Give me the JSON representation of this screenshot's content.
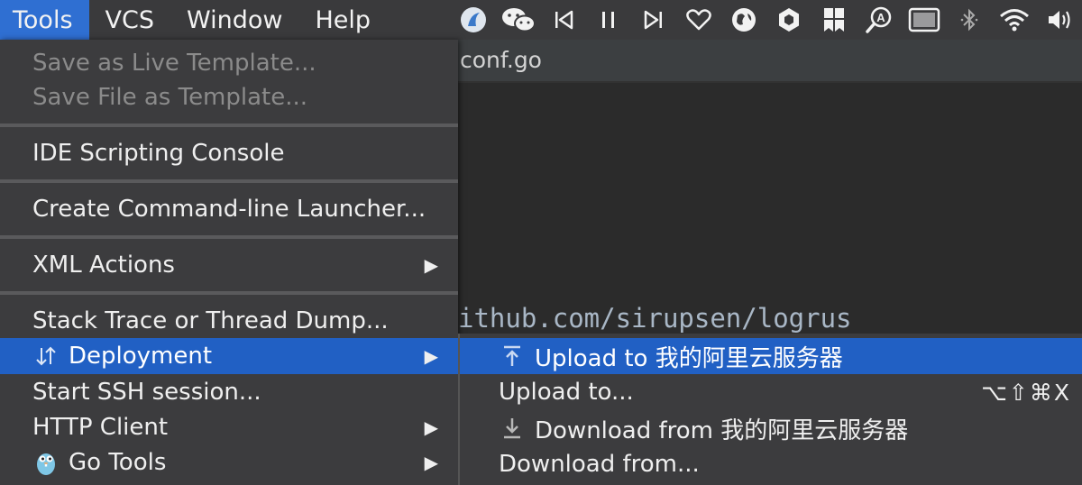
{
  "menubar": {
    "menus": [
      "Tools",
      "VCS",
      "Window",
      "Help"
    ],
    "tray_icons": [
      "app-circle-icon",
      "wechat-icon",
      "previous-track-icon",
      "pause-icon",
      "next-track-icon",
      "heart-icon",
      "globe-icon",
      "hexagon-icon",
      "bookmark-grid-icon",
      "search-a-icon",
      "display-icon",
      "bluetooth-icon",
      "wifi-icon",
      "volume-icon"
    ]
  },
  "editor": {
    "tab_title": "conf.go",
    "code_line": "ithub.com/sirupsen/logrus"
  },
  "tools_menu": {
    "items": [
      {
        "label": "Save as Live Template...",
        "disabled": true
      },
      {
        "label": "Save File as Template...",
        "disabled": true
      },
      {
        "label": "IDE Scripting Console"
      },
      {
        "label": "Create Command-line Launcher..."
      },
      {
        "label": "XML Actions",
        "submenu": true
      },
      {
        "label": "Stack Trace or Thread Dump..."
      },
      {
        "label": "Deployment",
        "submenu": true,
        "icon": "sort-arrows-icon",
        "highlighted": true
      },
      {
        "label": "Start SSH session..."
      },
      {
        "label": "HTTP Client",
        "submenu": true
      },
      {
        "label": "Go Tools",
        "submenu": true,
        "icon": "gopher-icon"
      }
    ],
    "arrow_glyph": "▶"
  },
  "deployment_submenu": {
    "items": [
      {
        "label": "Upload to 我的阿里云服务器",
        "icon": "upload-icon",
        "highlighted": true
      },
      {
        "label": "Upload to...",
        "shortcut": "⌥⇧⌘X"
      },
      {
        "label": "Download from 我的阿里云服务器",
        "icon": "download-icon"
      },
      {
        "label": "Download from..."
      }
    ]
  },
  "colors": {
    "highlight": "#2160c4",
    "menubar_active": "#2f6fd2",
    "menu_bg": "#3c3c3e",
    "disabled_text": "#8b8b8b"
  }
}
